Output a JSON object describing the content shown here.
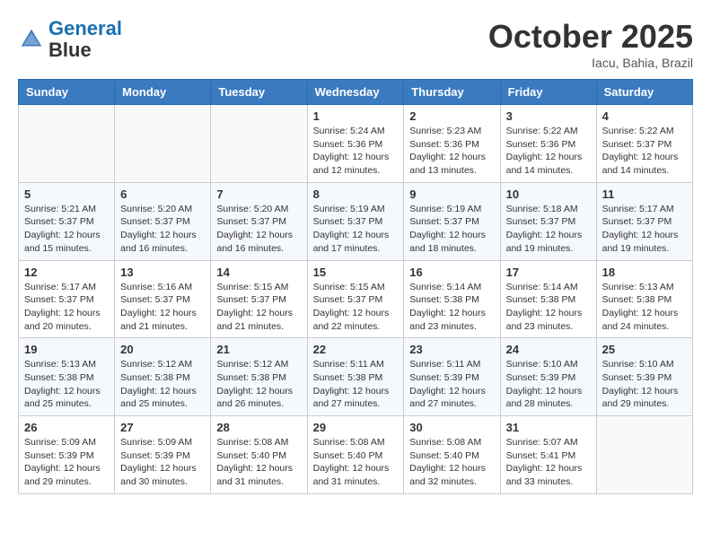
{
  "header": {
    "logo_line1": "General",
    "logo_line2": "Blue",
    "month": "October 2025",
    "location": "Iacu, Bahia, Brazil"
  },
  "days_of_week": [
    "Sunday",
    "Monday",
    "Tuesday",
    "Wednesday",
    "Thursday",
    "Friday",
    "Saturday"
  ],
  "weeks": [
    [
      {
        "day": "",
        "info": ""
      },
      {
        "day": "",
        "info": ""
      },
      {
        "day": "",
        "info": ""
      },
      {
        "day": "1",
        "info": "Sunrise: 5:24 AM\nSunset: 5:36 PM\nDaylight: 12 hours and 12 minutes."
      },
      {
        "day": "2",
        "info": "Sunrise: 5:23 AM\nSunset: 5:36 PM\nDaylight: 12 hours and 13 minutes."
      },
      {
        "day": "3",
        "info": "Sunrise: 5:22 AM\nSunset: 5:36 PM\nDaylight: 12 hours and 14 minutes."
      },
      {
        "day": "4",
        "info": "Sunrise: 5:22 AM\nSunset: 5:37 PM\nDaylight: 12 hours and 14 minutes."
      }
    ],
    [
      {
        "day": "5",
        "info": "Sunrise: 5:21 AM\nSunset: 5:37 PM\nDaylight: 12 hours and 15 minutes."
      },
      {
        "day": "6",
        "info": "Sunrise: 5:20 AM\nSunset: 5:37 PM\nDaylight: 12 hours and 16 minutes."
      },
      {
        "day": "7",
        "info": "Sunrise: 5:20 AM\nSunset: 5:37 PM\nDaylight: 12 hours and 16 minutes."
      },
      {
        "day": "8",
        "info": "Sunrise: 5:19 AM\nSunset: 5:37 PM\nDaylight: 12 hours and 17 minutes."
      },
      {
        "day": "9",
        "info": "Sunrise: 5:19 AM\nSunset: 5:37 PM\nDaylight: 12 hours and 18 minutes."
      },
      {
        "day": "10",
        "info": "Sunrise: 5:18 AM\nSunset: 5:37 PM\nDaylight: 12 hours and 19 minutes."
      },
      {
        "day": "11",
        "info": "Sunrise: 5:17 AM\nSunset: 5:37 PM\nDaylight: 12 hours and 19 minutes."
      }
    ],
    [
      {
        "day": "12",
        "info": "Sunrise: 5:17 AM\nSunset: 5:37 PM\nDaylight: 12 hours and 20 minutes."
      },
      {
        "day": "13",
        "info": "Sunrise: 5:16 AM\nSunset: 5:37 PM\nDaylight: 12 hours and 21 minutes."
      },
      {
        "day": "14",
        "info": "Sunrise: 5:15 AM\nSunset: 5:37 PM\nDaylight: 12 hours and 21 minutes."
      },
      {
        "day": "15",
        "info": "Sunrise: 5:15 AM\nSunset: 5:37 PM\nDaylight: 12 hours and 22 minutes."
      },
      {
        "day": "16",
        "info": "Sunrise: 5:14 AM\nSunset: 5:38 PM\nDaylight: 12 hours and 23 minutes."
      },
      {
        "day": "17",
        "info": "Sunrise: 5:14 AM\nSunset: 5:38 PM\nDaylight: 12 hours and 23 minutes."
      },
      {
        "day": "18",
        "info": "Sunrise: 5:13 AM\nSunset: 5:38 PM\nDaylight: 12 hours and 24 minutes."
      }
    ],
    [
      {
        "day": "19",
        "info": "Sunrise: 5:13 AM\nSunset: 5:38 PM\nDaylight: 12 hours and 25 minutes."
      },
      {
        "day": "20",
        "info": "Sunrise: 5:12 AM\nSunset: 5:38 PM\nDaylight: 12 hours and 25 minutes."
      },
      {
        "day": "21",
        "info": "Sunrise: 5:12 AM\nSunset: 5:38 PM\nDaylight: 12 hours and 26 minutes."
      },
      {
        "day": "22",
        "info": "Sunrise: 5:11 AM\nSunset: 5:38 PM\nDaylight: 12 hours and 27 minutes."
      },
      {
        "day": "23",
        "info": "Sunrise: 5:11 AM\nSunset: 5:39 PM\nDaylight: 12 hours and 27 minutes."
      },
      {
        "day": "24",
        "info": "Sunrise: 5:10 AM\nSunset: 5:39 PM\nDaylight: 12 hours and 28 minutes."
      },
      {
        "day": "25",
        "info": "Sunrise: 5:10 AM\nSunset: 5:39 PM\nDaylight: 12 hours and 29 minutes."
      }
    ],
    [
      {
        "day": "26",
        "info": "Sunrise: 5:09 AM\nSunset: 5:39 PM\nDaylight: 12 hours and 29 minutes."
      },
      {
        "day": "27",
        "info": "Sunrise: 5:09 AM\nSunset: 5:39 PM\nDaylight: 12 hours and 30 minutes."
      },
      {
        "day": "28",
        "info": "Sunrise: 5:08 AM\nSunset: 5:40 PM\nDaylight: 12 hours and 31 minutes."
      },
      {
        "day": "29",
        "info": "Sunrise: 5:08 AM\nSunset: 5:40 PM\nDaylight: 12 hours and 31 minutes."
      },
      {
        "day": "30",
        "info": "Sunrise: 5:08 AM\nSunset: 5:40 PM\nDaylight: 12 hours and 32 minutes."
      },
      {
        "day": "31",
        "info": "Sunrise: 5:07 AM\nSunset: 5:41 PM\nDaylight: 12 hours and 33 minutes."
      },
      {
        "day": "",
        "info": ""
      }
    ]
  ]
}
